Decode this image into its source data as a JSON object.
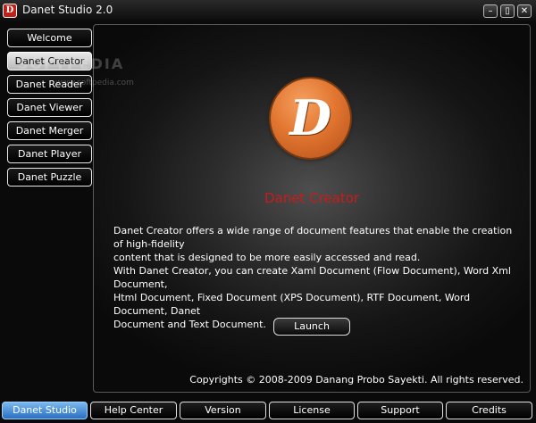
{
  "window": {
    "title": "Danet Studio 2.0",
    "icon_letter": "D"
  },
  "window_controls": [
    {
      "name": "minimize-button",
      "glyph": "–"
    },
    {
      "name": "maximize-button",
      "glyph": "▯"
    },
    {
      "name": "close-button",
      "glyph": "✕"
    }
  ],
  "sidebar": {
    "items": [
      {
        "label": "Welcome",
        "active": false
      },
      {
        "label": "Danet Creator",
        "active": true
      },
      {
        "label": "Danet Reader",
        "active": false
      },
      {
        "label": "Danet Viewer",
        "active": false
      },
      {
        "label": "Danet Merger",
        "active": false
      },
      {
        "label": "Danet Player",
        "active": false
      },
      {
        "label": "Danet Puzzle",
        "active": false
      }
    ]
  },
  "watermark": {
    "text": "SOFTPEDIA",
    "sub": "www.softpedia.com"
  },
  "main": {
    "logo_letter": "D",
    "heading": "Danet Creator",
    "paragraph_1_lines": [
      "Danet Creator offers a wide range of document features that enable the creation of high-fidelity",
      "content that is designed to be more easily accessed and read."
    ],
    "paragraph_2_lines": [
      "With Danet Creator, you can create Xaml Document (Flow Document), Word Xml Document,",
      "Html Document, Fixed Document (XPS Document), RTF Document, Word Document, Danet",
      "Document and Text Document."
    ],
    "launch_label": "Launch",
    "copyright": "Copyrights © 2008-2009 Danang Probo Sayekti. All rights reserved."
  },
  "bottom_nav": [
    {
      "label": "Danet Studio",
      "active": true
    },
    {
      "label": "Help Center",
      "active": false
    },
    {
      "label": "Version",
      "active": false
    },
    {
      "label": "License",
      "active": false
    },
    {
      "label": "Support",
      "active": false
    },
    {
      "label": "Credits",
      "active": false
    }
  ],
  "colors": {
    "accent_heading": "#cc1a1a",
    "logo_orange": "#e27630",
    "active_tab_blue": "#2b6fc2"
  }
}
